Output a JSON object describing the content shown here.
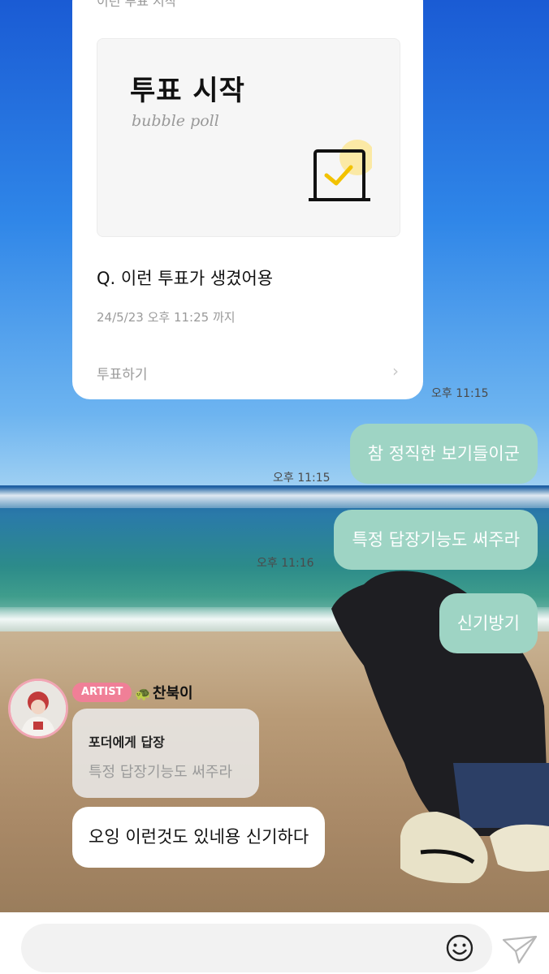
{
  "poll_card": {
    "header_partial": "이런 투표 시작",
    "banner_title": "투표 시작",
    "banner_subtitle": "bubble poll",
    "question": "Q. 이런 투표가 생겼어용",
    "deadline": "24/5/23 오후 11:25 까지",
    "vote_label": "투표하기",
    "time": "오후 11:15"
  },
  "messages_out": [
    {
      "text": "참 정직한 보기들이군",
      "time": "오후 11:15"
    },
    {
      "text": "특정 답장기능도 써주라",
      "time": "오후 11:16"
    },
    {
      "text": "신기방기"
    }
  ],
  "artist_reply": {
    "badge": "ARTIST",
    "sender": "찬북이",
    "reply_to": "포더에게 답장",
    "quoted": "특정 답장기능도 써주라",
    "text": "오잉 이런것도 있네용 신기하다"
  },
  "input": {
    "placeholder": ""
  },
  "colors": {
    "out_bubble": "#9ed4c4",
    "artist_badge": "#f07f97",
    "avatar_ring": "#f1a6b4"
  },
  "icons": {
    "emoji": "smiley-icon",
    "send": "paper-plane-icon",
    "ballot": "ballot-box-icon",
    "chevron": "chevron-right-icon"
  }
}
